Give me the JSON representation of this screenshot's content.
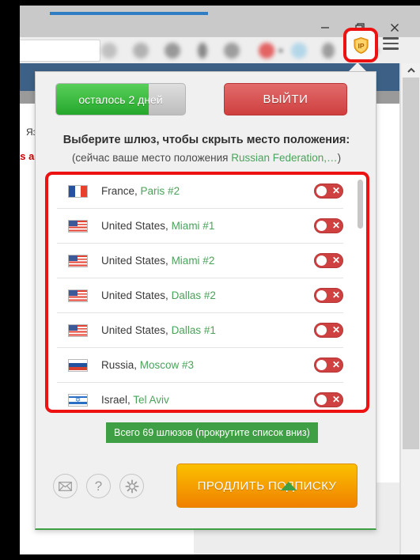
{
  "window": {
    "minimize_label": "minimize",
    "maximize_label": "restore",
    "close_label": "close"
  },
  "toolbar": {
    "extension_icon": "shield-ip-icon",
    "extension_icon_text": "IP",
    "menu_label": "menu"
  },
  "background_page": {
    "language_label": "Язык",
    "red_text": "as a"
  },
  "popup": {
    "trial": {
      "label": "осталось 2 дней",
      "fill_percent": 72
    },
    "exit_button": "ВЫЙТИ",
    "heading": "Выберите шлюз, чтобы скрыть место положения:",
    "subheading_prefix": "(сейчас ваше место положения ",
    "subheading_location": "Russian Federation,…",
    "subheading_suffix": ")",
    "gateways": [
      {
        "flag": "fr",
        "country": "France,",
        "city": "Paris #2",
        "toggle": "off"
      },
      {
        "flag": "us",
        "country": "United States,",
        "city": "Miami #1",
        "toggle": "off"
      },
      {
        "flag": "us",
        "country": "United States,",
        "city": "Miami #2",
        "toggle": "off"
      },
      {
        "flag": "us",
        "country": "United States,",
        "city": "Dallas #2",
        "toggle": "off"
      },
      {
        "flag": "us",
        "country": "United States,",
        "city": "Dallas #1",
        "toggle": "off"
      },
      {
        "flag": "ru",
        "country": "Russia,",
        "city": "Moscow #3",
        "toggle": "off"
      },
      {
        "flag": "il",
        "country": "Israel,",
        "city": "Tel Aviv",
        "toggle": "off"
      }
    ],
    "tooltip": "Всего 69 шлюзов (прокрутите список вниз)",
    "footer_icons": [
      {
        "name": "mail-icon",
        "glyph": "✉"
      },
      {
        "name": "help-icon",
        "glyph": "?"
      },
      {
        "name": "gear-icon",
        "glyph": "✲"
      }
    ],
    "renew_button": "ПРОДЛИТЬ ПОДПИСКУ"
  },
  "colors": {
    "accent_green": "#3f9f45",
    "accent_red": "#cf4141",
    "accent_orange": "#f08000",
    "highlight_red": "#ee1111"
  }
}
